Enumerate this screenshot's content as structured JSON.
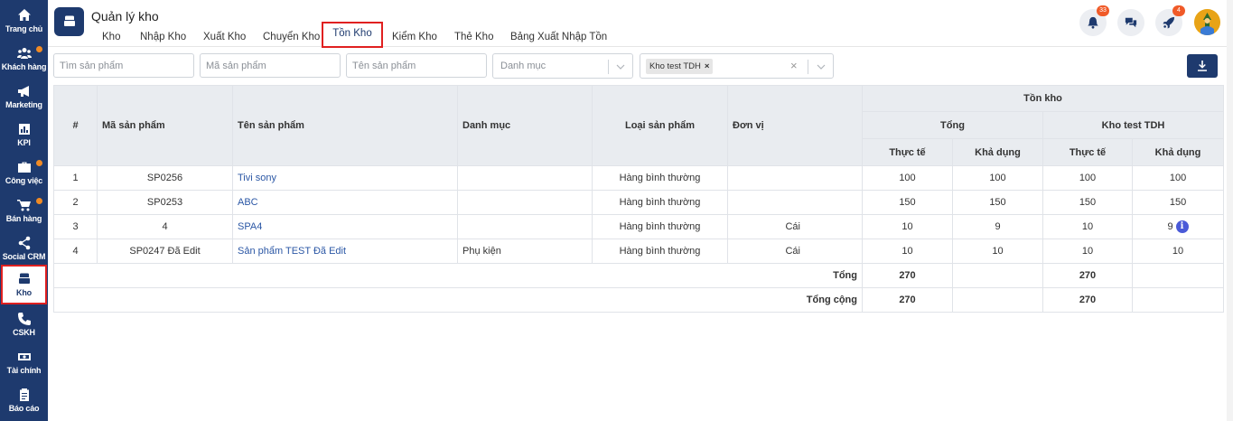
{
  "sidebar": {
    "items": [
      {
        "label": "Trang chủ",
        "icon": "home-icon"
      },
      {
        "label": "Khách hàng",
        "icon": "users-icon",
        "dot": true
      },
      {
        "label": "Marketing",
        "icon": "megaphone-icon"
      },
      {
        "label": "KPI",
        "icon": "chart-icon"
      },
      {
        "label": "Công việc",
        "icon": "briefcase-icon",
        "dot": true
      },
      {
        "label": "Bán hàng",
        "icon": "cart-icon",
        "dot": true
      },
      {
        "label": "Social CRM",
        "icon": "share-icon"
      },
      {
        "label": "Kho",
        "icon": "warehouse-icon",
        "active": true
      },
      {
        "label": "CSKH",
        "icon": "phone-icon"
      },
      {
        "label": "Tài chính",
        "icon": "money-icon"
      },
      {
        "label": "Báo cáo",
        "icon": "report-icon"
      }
    ]
  },
  "header": {
    "title": "Quản lý kho",
    "tabs": [
      "Kho",
      "Nhập Kho",
      "Xuất Kho",
      "Chuyển Kho",
      "Tồn Kho",
      "Kiểm Kho",
      "Thẻ Kho",
      "Bảng Xuất Nhập Tồn"
    ],
    "active_tab": "Tồn Kho",
    "notifications_count": "33",
    "rocket_count": "4"
  },
  "filters": {
    "search_product_placeholder": "Tìm sản phẩm",
    "product_code_placeholder": "Mã sản phẩm",
    "product_name_placeholder": "Tên sản phẩm",
    "category_placeholder": "Danh mục",
    "warehouse_chip": "Kho test TDH",
    "chip_remove": "×",
    "clear": "×"
  },
  "table": {
    "headers": {
      "index": "#",
      "code": "Mã sản phẩm",
      "name": "Tên sản phẩm",
      "category": "Danh mục",
      "type": "Loại sản phẩm",
      "unit": "Đơn vị",
      "stock": "Tồn kho",
      "total": "Tổng",
      "warehouse": "Kho test TDH",
      "actual": "Thực tế",
      "available": "Khả dụng"
    },
    "rows": [
      {
        "index": "1",
        "code": "SP0256",
        "name": "Tivi sony",
        "category": "",
        "type": "Hàng bình thường",
        "unit": "",
        "total_actual": "100",
        "total_available": "100",
        "wh_actual": "100",
        "wh_available": "100"
      },
      {
        "index": "2",
        "code": "SP0253",
        "name": "ABC",
        "category": "",
        "type": "Hàng bình thường",
        "unit": "",
        "total_actual": "150",
        "total_available": "150",
        "wh_actual": "150",
        "wh_available": "150"
      },
      {
        "index": "3",
        "code": "4",
        "name": "SPA4",
        "category": "",
        "type": "Hàng bình thường",
        "unit": "Cái",
        "total_actual": "10",
        "total_available": "9",
        "wh_actual": "10",
        "wh_available": "9"
      },
      {
        "index": "4",
        "code": "SP0247 Đã Edit",
        "name": "Sản phẩm TEST Đã Edit",
        "category": "Phụ kiện",
        "type": "Hàng bình thường",
        "unit": "Cái",
        "total_actual": "10",
        "total_available": "10",
        "wh_actual": "10",
        "wh_available": "10"
      }
    ],
    "summary": [
      {
        "label": "Tổng",
        "total_actual": "270",
        "wh_actual": "270"
      },
      {
        "label": "Tổng cộng",
        "total_actual": "270",
        "wh_actual": "270"
      }
    ]
  }
}
